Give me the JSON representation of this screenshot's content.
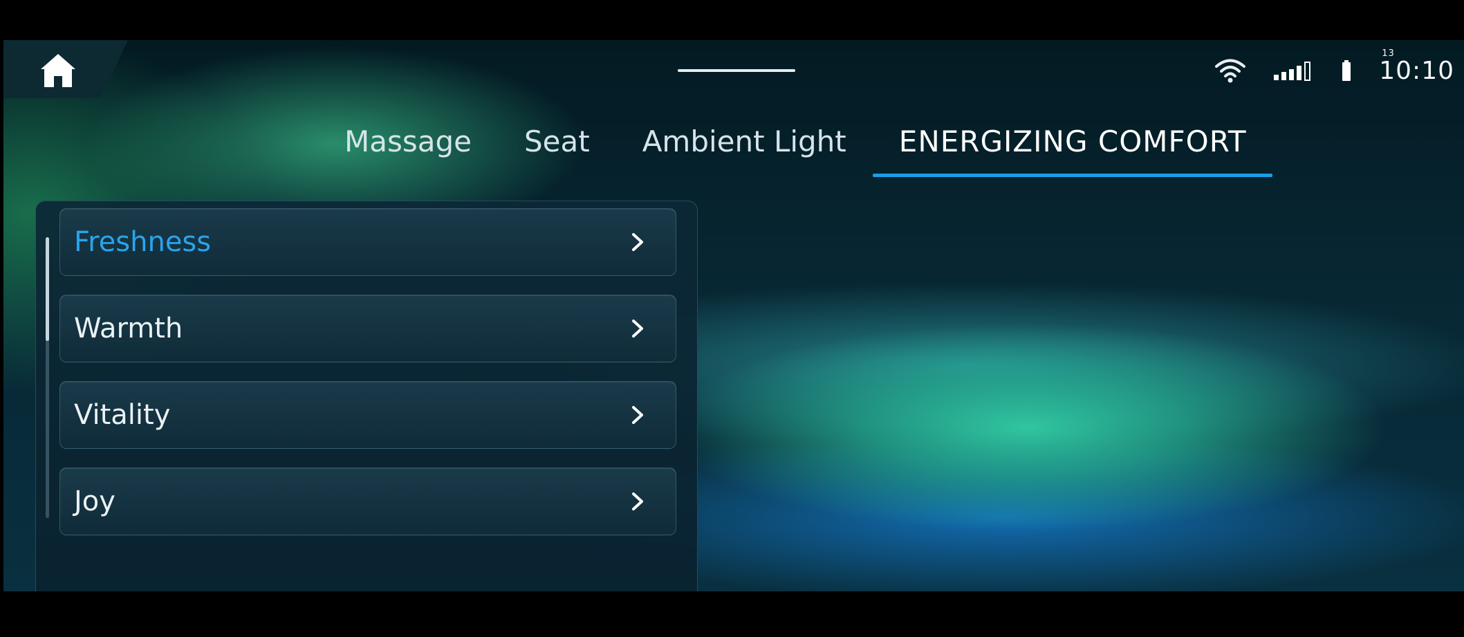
{
  "status": {
    "time": "10:10",
    "time_superscript": "13"
  },
  "tabs": [
    {
      "label": "Massage"
    },
    {
      "label": "Seat"
    },
    {
      "label": "Ambient Light"
    },
    {
      "label": "ENERGIZING COMFORT",
      "active": true
    }
  ],
  "menu": {
    "items": [
      {
        "label": "Freshness",
        "selected": true
      },
      {
        "label": "Warmth"
      },
      {
        "label": "Vitality"
      },
      {
        "label": "Joy"
      }
    ]
  },
  "colors": {
    "accent": "#1a9ee8",
    "selected_text": "#2ba3ec"
  }
}
